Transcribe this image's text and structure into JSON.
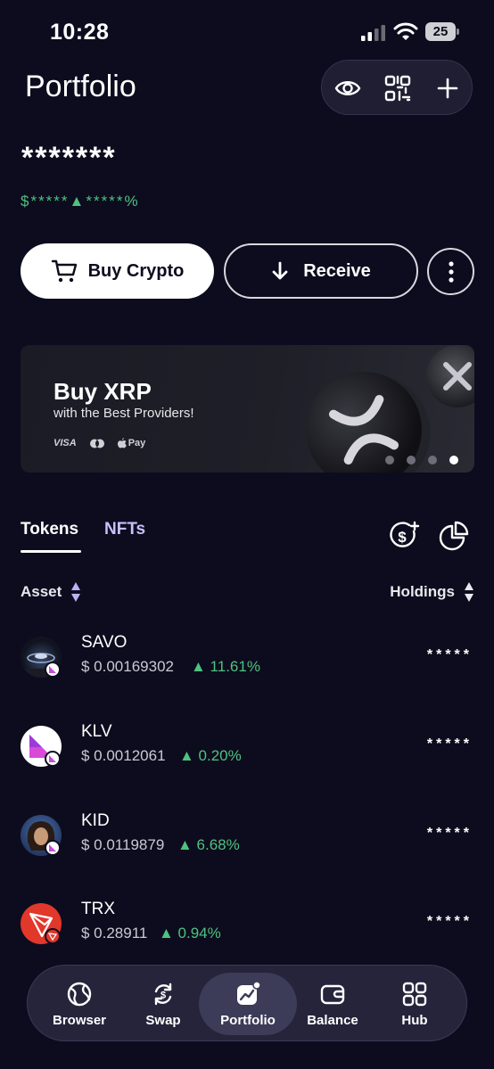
{
  "status": {
    "time": "10:28",
    "battery": "25"
  },
  "header": {
    "title": "Portfolio"
  },
  "balance": {
    "masked": "*******",
    "change_masked": "$*****▲*****%"
  },
  "actions": {
    "buy_label": "Buy Crypto",
    "receive_label": "Receive"
  },
  "banner": {
    "title": "Buy XRP",
    "subtitle": "with the Best Providers!",
    "payment_methods": [
      "VISA",
      "Pay"
    ],
    "slides_total": 4,
    "active_slide": 4
  },
  "tabs": {
    "tokens": "Tokens",
    "nfts": "NFTs",
    "active": "Tokens"
  },
  "columns": {
    "asset": "Asset",
    "holdings": "Holdings"
  },
  "tokens": [
    {
      "symbol": "SAVO",
      "price": "$ 0.00169302",
      "change": "▲ 11.61%",
      "holding": "*****"
    },
    {
      "symbol": "KLV",
      "price": "$ 0.0012061",
      "change": "▲ 0.20%",
      "holding": "*****"
    },
    {
      "symbol": "KID",
      "price": "$ 0.0119879",
      "change": "▲ 6.68%",
      "holding": "*****"
    },
    {
      "symbol": "TRX",
      "price": "$ 0.28911",
      "change": "▲ 0.94%",
      "holding": "*****"
    }
  ],
  "nav": {
    "items": [
      {
        "label": "Browser",
        "icon": "globe-icon"
      },
      {
        "label": "Swap",
        "icon": "swap-icon"
      },
      {
        "label": "Portfolio",
        "icon": "chart-icon"
      },
      {
        "label": "Balance",
        "icon": "wallet-icon"
      },
      {
        "label": "Hub",
        "icon": "grid-icon"
      }
    ],
    "active": "Portfolio"
  },
  "colors": {
    "background": "#0d0c1e",
    "positive": "#4ec27f",
    "accent": "#c6c0ff"
  }
}
